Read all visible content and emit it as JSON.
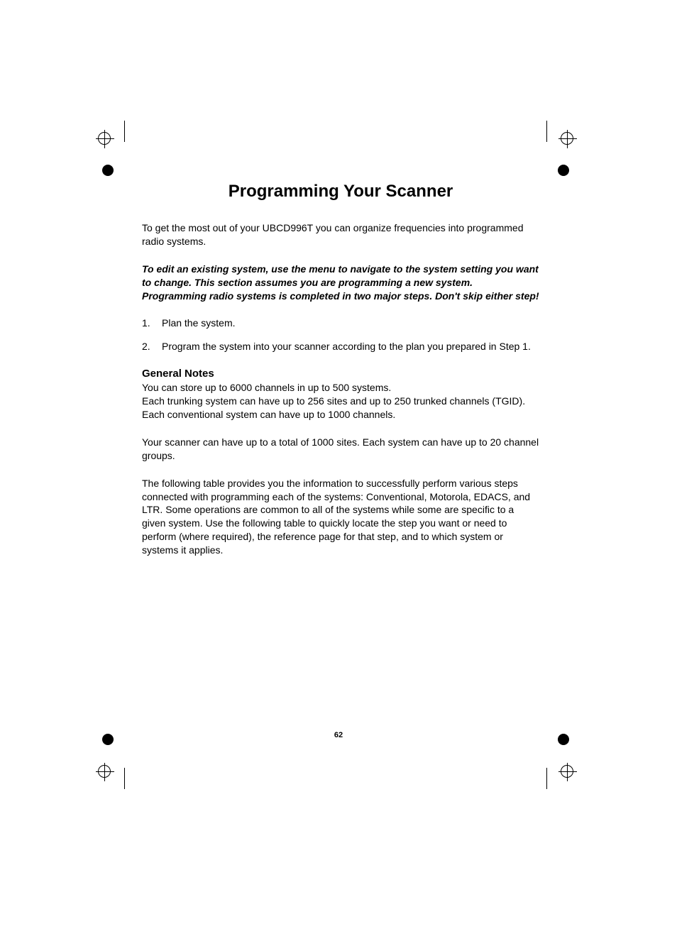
{
  "title": "Programming Your Scanner",
  "intro": "To get the most out of your UBCD996T you can organize frequencies into programmed radio systems.",
  "emphasis": "To edit an existing system, use the menu to navigate to the system setting you want to change. This section assumes you are programming a new system. Programming radio systems is completed in two major steps. Don't skip either step!",
  "steps": [
    {
      "num": "1.",
      "text": "Plan the system."
    },
    {
      "num": "2.",
      "text": "Program the system into your scanner according to the plan you prepared in Step 1."
    }
  ],
  "subhead": "General Notes",
  "notes_p1": "You can store up to 6000 channels in up to 500 systems.\nEach trunking system can have up to 256 sites and up to 250 trunked channels (TGID). Each conventional system can have up to 1000 channels.",
  "notes_p2": "Your scanner can have up to a total of 1000 sites. Each system can have up to 20 channel groups.",
  "notes_p3": "The following table provides you the information to successfully perform various steps connected with programming each of the systems: Conventional, Motorola, EDACS, and LTR. Some operations are common to all of the systems while some are specific to a given system. Use the following table to quickly locate the step you want or need to perform (where required), the reference page for that step, and to which system or systems it applies.",
  "page_number": "62"
}
